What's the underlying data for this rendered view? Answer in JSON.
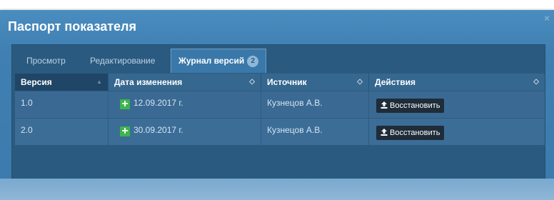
{
  "dialog": {
    "title": "Паспорт показателя",
    "close_glyph": "×"
  },
  "tabs": [
    {
      "label": "Просмотр"
    },
    {
      "label": "Редактирование"
    },
    {
      "label": "Журнал версий",
      "badge": "2",
      "active": true
    }
  ],
  "table": {
    "columns": [
      {
        "label": "Версия",
        "sort": "asc"
      },
      {
        "label": "Дата изменения",
        "sort": "none"
      },
      {
        "label": "Источник",
        "sort": "none"
      },
      {
        "label": "Действия",
        "sort": "none"
      }
    ],
    "sort_glyphs": {
      "asc": "▲",
      "none": "◇"
    },
    "rows": [
      {
        "version": "1.0",
        "date": "12.09.2017 г.",
        "source": "Кузнецов А.В.",
        "action": "Восстановить"
      },
      {
        "version": "2.0",
        "date": "30.09.2017 г.",
        "source": "Кузнецов А.В.",
        "action": "Восстановить"
      }
    ]
  },
  "icons": {
    "plus": "plus-icon",
    "restore": "upload-icon",
    "close": "close-icon"
  },
  "colors": {
    "header_bar": "#3f7fb2",
    "panel": "#2b5a80",
    "add_green": "#3db54a",
    "button_dark": "#1f2c39"
  }
}
